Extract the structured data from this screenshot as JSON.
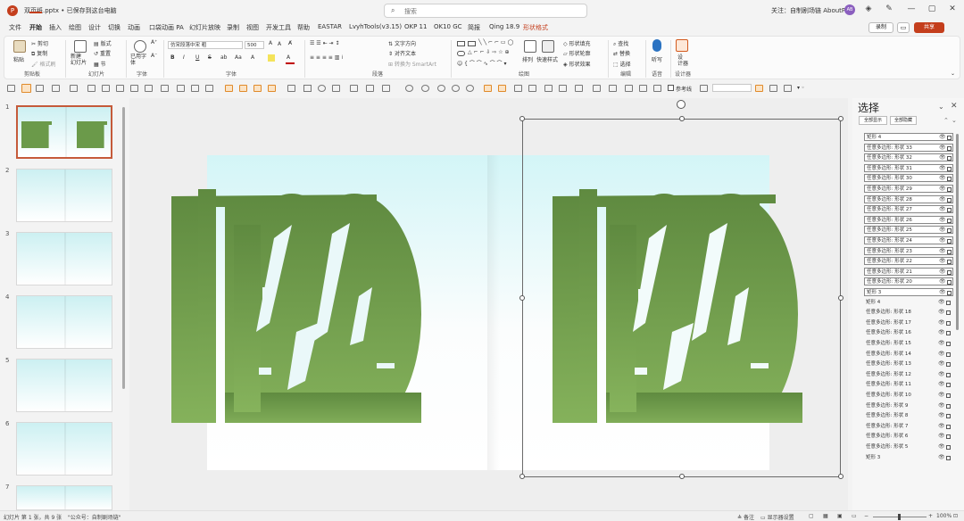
{
  "title_bar": {
    "file_name": "双页纸.pptx • 已保存到这台电脑",
    "search_placeholder": "搜索",
    "account_text": "关注：自制剧场链 AboutPPT",
    "avatar_initials": "AB"
  },
  "menu_tabs": [
    "文件",
    "开始",
    "插入",
    "绘图",
    "设计",
    "切换",
    "动画",
    "口袋动画 PA",
    "幻灯片放映",
    "录制",
    "视图",
    "开发工具",
    "帮助",
    "EASTAR",
    "LvyhTools(v3.15)",
    "OKP 11",
    "OK10 GC",
    "简报",
    "Qing 18.9",
    "形状格式"
  ],
  "active_tab": "开始",
  "context_tab": "形状格式",
  "header_buttons": {
    "record": "录制",
    "share": "共享"
  },
  "ribbon": {
    "clipboard": {
      "paste": "粘贴",
      "cut": "剪切",
      "copy": "复制",
      "format_painter": "格式刷",
      "label": "剪贴板"
    },
    "slides": {
      "new_slide": "新建\n幻灯片",
      "layout": "版式",
      "reset": "重置",
      "section": "节",
      "label": "幻灯片"
    },
    "reuse": {
      "reuse": "已用字\n体",
      "label": "字体"
    },
    "font": {
      "name": "仿宋段落中宋 粗",
      "size": "500",
      "bold": "B",
      "italic": "I",
      "underline": "U",
      "strike": "S",
      "label": "字体"
    },
    "paragraph": {
      "text_direction": "文字方向",
      "align_text": "对齐文本",
      "smartart": "转换为 SmartArt",
      "label": "段落"
    },
    "drawing": {
      "arrange": "排列",
      "quick_styles": "快速样式",
      "fill": "形状填充",
      "outline": "形状轮廓",
      "effects": "形状效果",
      "label": "绘图"
    },
    "editing": {
      "find": "查找",
      "replace": "替换",
      "select": "选择",
      "label": "编辑"
    },
    "voice": {
      "dictate": "听写",
      "label": "语音"
    },
    "designer": {
      "designer": "设\n计器",
      "label": "设计器"
    }
  },
  "format_toolbar": {
    "guides_label": "参考线"
  },
  "slides_panel": {
    "numbers": [
      "1",
      "2",
      "3",
      "4",
      "5",
      "6",
      "7"
    ],
    "selected": "1"
  },
  "main_slide": {
    "glyph_color": "#6b9a4a",
    "glyph_color_light": "#86b35c",
    "bg_top": "#d3f5f7"
  },
  "selection_pane": {
    "title": "选择",
    "show_all": "全部显示",
    "hide_all": "全部隐藏",
    "items": [
      {
        "name": "矩形 4",
        "boxed": true
      },
      {
        "name": "任意多边形: 形状 33",
        "boxed": true
      },
      {
        "name": "任意多边形: 形状 32",
        "boxed": true
      },
      {
        "name": "任意多边形: 形状 31",
        "boxed": true
      },
      {
        "name": "任意多边形: 形状 30",
        "boxed": true
      },
      {
        "name": "任意多边形: 形状 29",
        "boxed": true
      },
      {
        "name": "任意多边形: 形状 28",
        "boxed": true
      },
      {
        "name": "任意多边形: 形状 27",
        "boxed": true
      },
      {
        "name": "任意多边形: 形状 26",
        "boxed": true
      },
      {
        "name": "任意多边形: 形状 25",
        "boxed": true
      },
      {
        "name": "任意多边形: 形状 24",
        "boxed": true
      },
      {
        "name": "任意多边形: 形状 23",
        "boxed": true
      },
      {
        "name": "任意多边形: 形状 22",
        "boxed": true
      },
      {
        "name": "任意多边形: 形状 21",
        "boxed": true
      },
      {
        "name": "任意多边形: 形状 20",
        "boxed": true
      },
      {
        "name": "矩形 3",
        "boxed": true
      },
      {
        "name": "矩形 4",
        "boxed": false
      },
      {
        "name": "任意多边形: 形状 18",
        "boxed": false
      },
      {
        "name": "任意多边形: 形状 17",
        "boxed": false
      },
      {
        "name": "任意多边形: 形状 16",
        "boxed": false
      },
      {
        "name": "任意多边形: 形状 15",
        "boxed": false
      },
      {
        "name": "任意多边形: 形状 14",
        "boxed": false
      },
      {
        "name": "任意多边形: 形状 13",
        "boxed": false
      },
      {
        "name": "任意多边形: 形状 12",
        "boxed": false
      },
      {
        "name": "任意多边形: 形状 11",
        "boxed": false
      },
      {
        "name": "任意多边形: 形状 10",
        "boxed": false
      },
      {
        "name": "任意多边形: 形状 9",
        "boxed": false
      },
      {
        "name": "任意多边形: 形状 8",
        "boxed": false
      },
      {
        "name": "任意多边形: 形状 7",
        "boxed": false
      },
      {
        "name": "任意多边形: 形状 6",
        "boxed": false
      },
      {
        "name": "任意多边形: 形状 5",
        "boxed": false
      },
      {
        "name": "矩形 3",
        "boxed": false
      }
    ]
  },
  "status_bar": {
    "slide_info": "幻灯片 第 1 张，共 9 张",
    "account_note": "\"公众号：自制剧场链\"",
    "notes": "备注",
    "display_settings": "显示器设置",
    "zoom": "100%"
  }
}
